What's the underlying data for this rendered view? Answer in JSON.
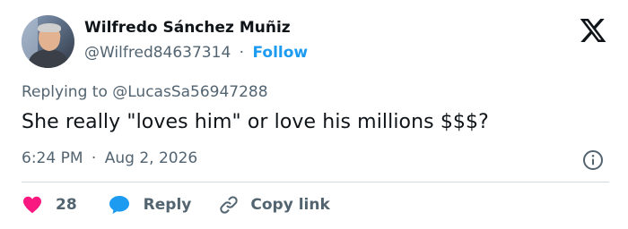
{
  "author": {
    "name": "Wilfredo Sánchez Muñiz",
    "handle": "@Wilfred84637314",
    "separator": "·",
    "follow_label": "Follow"
  },
  "reply_context": {
    "prefix": "Replying to ",
    "handle": "@LucasSa56947288"
  },
  "tweet": {
    "text": "She really \"loves him\" or love his millions $$$?",
    "time": "6:24 PM",
    "separator": "·",
    "date": "Aug 2, 2026"
  },
  "actions": {
    "like_count": "28",
    "reply_label": "Reply",
    "copy_link_label": "Copy link"
  },
  "icons": {
    "brand": "x-logo-icon",
    "info": "info-icon",
    "like": "heart-icon",
    "reply": "speech-bubble-icon",
    "copy": "link-icon"
  },
  "colors": {
    "text": "#0f1419",
    "secondary": "#536471",
    "accent": "#1d9bf0",
    "like": "#f91880",
    "divider": "#cfd9de"
  }
}
